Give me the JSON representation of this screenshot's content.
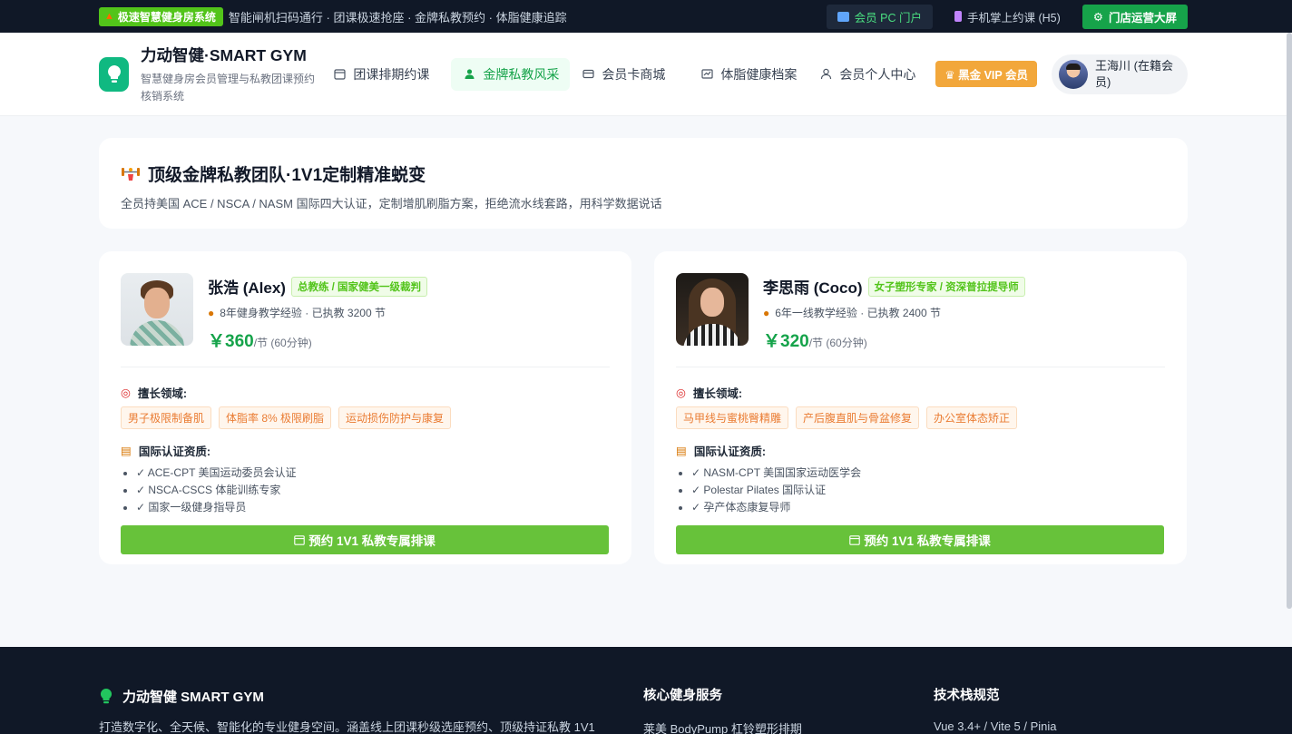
{
  "topbar": {
    "tag": "极速智慧健身房系统",
    "ticker": "智能闸机扫码通行 · 团课极速抢座 · 金牌私教预约 · 体脂健康追踪",
    "portal_label": "会员 PC 门户",
    "h5_label": "手机掌上约课 (H5)",
    "screen_label": "门店运营大屏"
  },
  "header": {
    "title": "力动智健·SMART GYM",
    "subtitle": "智慧健身房会员管理与私教团课预约核销系统",
    "nav": [
      {
        "label": "团课排期约课",
        "icon": "calendar-icon"
      },
      {
        "label": "金牌私教风采",
        "icon": "user-icon"
      },
      {
        "label": "会员卡商城",
        "icon": "card-icon"
      },
      {
        "label": "体脂健康档案",
        "icon": "chart-icon"
      },
      {
        "label": "会员个人中心",
        "icon": "person-icon"
      }
    ],
    "vip_label": "黑金 VIP 会员",
    "user_name": "王海川 (在籍会员)"
  },
  "hero": {
    "title": "顶级金牌私教团队·1V1定制精准蜕变",
    "subtitle": "全员持美国 ACE / NSCA / NASM 国际四大认证，定制增肌刷脂方案，拒绝流水线套路，用科学数据说话"
  },
  "coaches": [
    {
      "name": "张浩 (Alex)",
      "badge": "总教练 / 国家健美一级裁判",
      "experience": "8年健身教学经验 · 已执教 3200 节",
      "price": "￥360",
      "price_unit": "/节 (60分钟)",
      "specialty_title": "擅长领域:",
      "specialties": [
        "男子极限制备肌",
        "体脂率 8% 极限刷脂",
        "运动损伤防护与康复"
      ],
      "cert_title": "国际认证资质:",
      "certs": [
        "✓ ACE-CPT 美国运动委员会认证",
        "✓ NSCA-CSCS 体能训练专家",
        "✓ 国家一级健身指导员"
      ],
      "button": "预约 1V1 私教专属排课"
    },
    {
      "name": "李思雨 (Coco)",
      "badge": "女子塑形专家 / 资深普拉提导师",
      "experience": "6年一线教学经验 · 已执教 2400 节",
      "price": "￥320",
      "price_unit": "/节 (60分钟)",
      "specialty_title": "擅长领域:",
      "specialties": [
        "马甲线与蜜桃臀精雕",
        "产后腹直肌与骨盆修复",
        "办公室体态矫正"
      ],
      "cert_title": "国际认证资质:",
      "certs": [
        "✓ NASM-CPT 美国国家运动医学会",
        "✓ Polestar Pilates 国际认证",
        "✓ 孕产体态康复导师"
      ],
      "button": "预约 1V1 私教专属排课"
    }
  ],
  "footer": {
    "brand": "力动智健 SMART GYM",
    "desc": "打造数字化、全天候、智能化的专业健身空间。涵盖线上团课秒级选座预约、顶级持证私教 1V1",
    "col1_title": "核心健身服务",
    "col1_link": "莱美 BodyPump 杠铃塑形排期",
    "col2_title": "技术栈规范",
    "col2_link": "Vue 3.4+ / Vite 5 / Pinia"
  },
  "colors": {
    "accent": "#16a34a",
    "button": "#67c23a",
    "vip": "#f2a73b",
    "dark": "#101827"
  }
}
